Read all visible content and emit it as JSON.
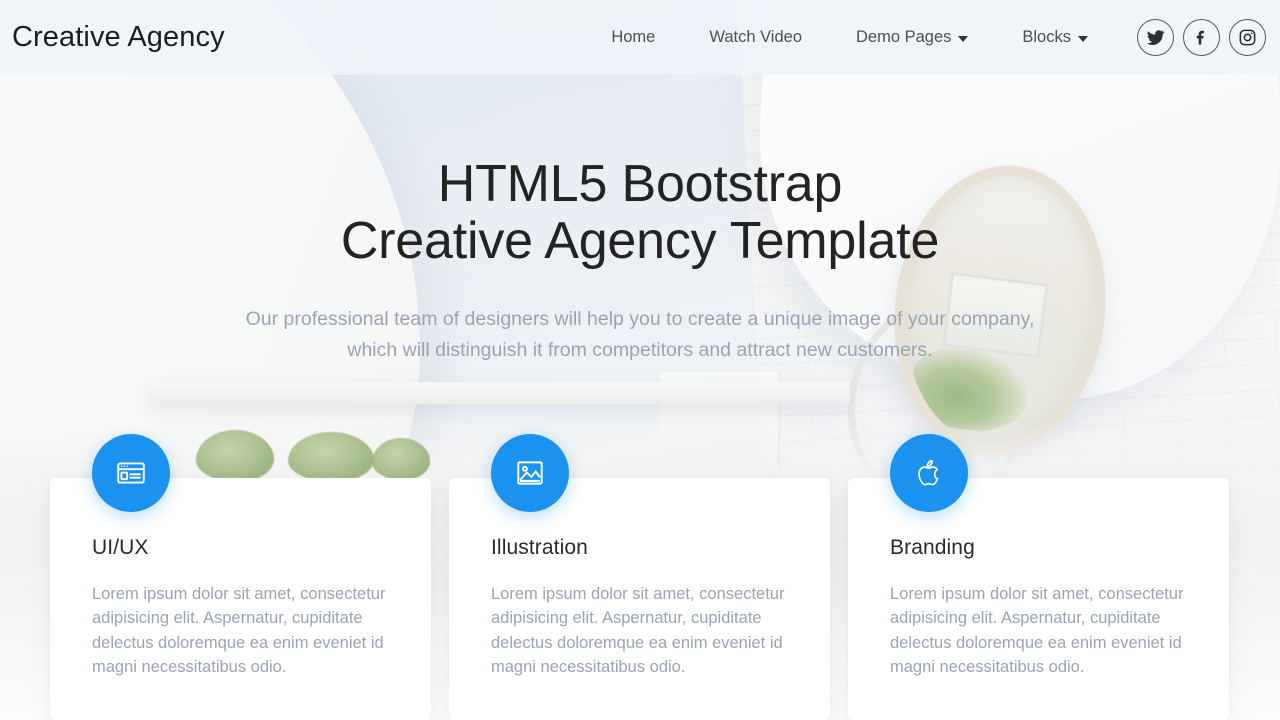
{
  "navbar": {
    "brand": "Creative Agency",
    "links": [
      {
        "label": "Home",
        "has_caret": false
      },
      {
        "label": "Watch Video",
        "has_caret": false
      },
      {
        "label": "Demo Pages",
        "has_caret": true
      },
      {
        "label": "Blocks",
        "has_caret": true
      }
    ],
    "socials": [
      {
        "name": "twitter",
        "title": "Twitter"
      },
      {
        "name": "facebook",
        "title": "Facebook"
      },
      {
        "name": "instagram",
        "title": "Instagram"
      }
    ]
  },
  "hero": {
    "title_line1": "HTML5 Bootstrap",
    "title_line2": "Creative Agency Template",
    "subtitle_line1": "Our professional team of designers will help you to create a unique image of your company,",
    "subtitle_line2": "which will distinguish it from competitors and attract new customers."
  },
  "cards": [
    {
      "icon": "browser-window-icon",
      "title": "UI/UX",
      "text": "Lorem ipsum dolor sit amet, consectetur adipisicing elit. Aspernatur, cupiditate delectus doloremque ea enim eveniet id magni necessitatibus odio."
    },
    {
      "icon": "image-picture-icon",
      "title": "Illustration",
      "text": "Lorem ipsum dolor sit amet, consectetur adipisicing elit. Aspernatur, cupiditate delectus doloremque ea enim eveniet id magni necessitatibus odio."
    },
    {
      "icon": "apple-logo-icon",
      "title": "Branding",
      "text": "Lorem ipsum dolor sit amet, consectetur adipisicing elit. Aspernatur, cupiditate delectus doloremque ea enim eveniet id magni necessitatibus odio."
    }
  ],
  "colors": {
    "accent": "#1b91f0",
    "heading": "#232323",
    "muted_text": "#9aa3b4",
    "nav_text": "#4c4f54",
    "navbar_bg": "#f0f3f8",
    "card_bg": "#ffffff"
  }
}
